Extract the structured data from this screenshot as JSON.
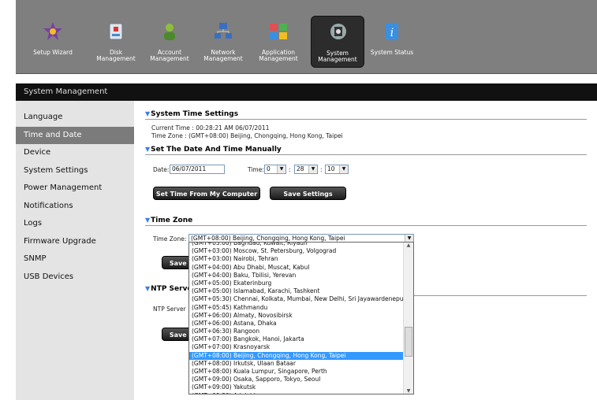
{
  "toolbar": {
    "items": [
      {
        "label": "Setup Wizard",
        "icon": "wizard-icon",
        "color": "#7a3fa0"
      },
      {
        "label": "Disk Management",
        "icon": "disk-icon",
        "color": "#cfd8e0"
      },
      {
        "label": "Account Management",
        "icon": "account-icon",
        "color": "#8fbf3a"
      },
      {
        "label": "Network Management",
        "icon": "network-icon",
        "color": "#3a6fc0"
      },
      {
        "label": "Application Management",
        "icon": "application-icon",
        "color": "#e05050"
      },
      {
        "label": "System Management",
        "icon": "system-icon",
        "color": "#888888"
      },
      {
        "label": "System Status",
        "icon": "status-icon",
        "color": "#3a8fe0"
      }
    ]
  },
  "section_title": "System Management",
  "sidebar": {
    "items": [
      "Language",
      "Time and Date",
      "Device",
      "System Settings",
      "Power Management",
      "Notifications",
      "Logs",
      "Firmware Upgrade",
      "SNMP",
      "USB Devices"
    ]
  },
  "time_settings": {
    "heading": "System Time Settings",
    "current_time": "Current Time : 00:28:21 AM 06/07/2011",
    "time_zone": "Time Zone : (GMT+08:00) Beijing, Chongqing, Hong Kong, Taipei"
  },
  "manual": {
    "heading": "Set The Date And Time Manually",
    "date_label": "Date:",
    "date_value": "06/07/2011",
    "time_label": "Time:",
    "hour": "0",
    "minute": "28",
    "second": "10",
    "sep": ":",
    "set_from_computer": "Set Time From My Computer",
    "save": "Save Settings"
  },
  "timezone": {
    "heading": "Time Zone",
    "label": "Time Zone:",
    "selected": "(GMT+08:00) Beijing, Chongqing, Hong Kong, Taipei",
    "save": "Save S"
  },
  "ntp": {
    "heading": "NTP Serve",
    "label": "NTP Server",
    "save": "Save S"
  },
  "dropdown": {
    "options": [
      "(GMT+03:00) Baghdad, Kuwait, Riyadh",
      "(GMT+03:00) Moscow, St. Petersburg, Volgograd",
      "(GMT+03:00) Nairobi, Tehran",
      "(GMT+04:00) Abu Dhabi, Muscat, Kabul",
      "(GMT+04:00) Baku, Tbilisi, Yerevan",
      "(GMT+05:00) Ekaterinburg",
      "(GMT+05:00) Islamabad, Karachi, Tashkent",
      "(GMT+05:30) Chennai, Kolkata, Mumbai, New Delhi, Sri Jayawardenepura",
      "(GMT+05:45) Kathmandu",
      "(GMT+06:00) Almaty, Novosibirsk",
      "(GMT+06:00) Astana, Dhaka",
      "(GMT+06:30) Rangoon",
      "(GMT+07:00) Bangkok, Hanoi, Jakarta",
      "(GMT+07:00) Krasnoyarsk",
      "(GMT+08:00) Beijing, Chongqing, Hong Kong, Taipei",
      "(GMT+08:00) Irkutsk, Ulaan Bataar",
      "(GMT+08:00) Kuala Lumpur, Singapore, Perth",
      "(GMT+09:00) Osaka, Sapporo, Tokyo, Seoul",
      "(GMT+09:00) Yakutsk",
      "(GMT+09:30) Adelaide"
    ],
    "selected_index": 14
  }
}
